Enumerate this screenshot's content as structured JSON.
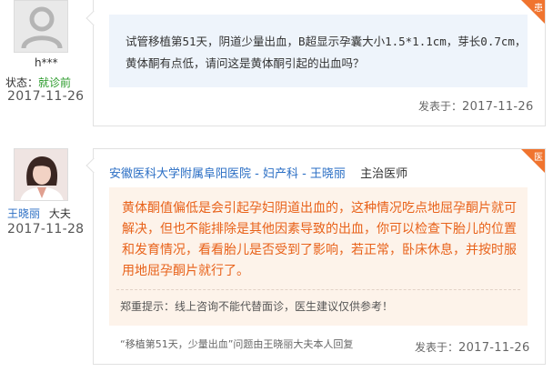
{
  "patient": {
    "name": "h***",
    "status_label": "状态：",
    "status_value": "就诊前",
    "date": "2017-11-26"
  },
  "question": {
    "badge": "患",
    "text": "试管移植第51天，阴道少量出血，B超显示孕囊大小1.5*1.1cm，芽长0.7cm，黄体酮有点低，请问这是黄体酮引起的出血吗？",
    "sent_label": "发表于：",
    "sent_date": "2017-11-26"
  },
  "doctor": {
    "name": "王晓丽",
    "role": "大夫",
    "date": "2017-11-28",
    "hospital_link": "安徽医科大学附属阜阳医院 - 妇产科 - 王晓丽",
    "title": "主治医师"
  },
  "answer": {
    "badge": "医",
    "text": "黄体酮值偏低是会引起孕妇阴道出血的，这种情况吃点地屈孕酮片就可解决，但也不能排除是其他因素导致的出血，你可以检查下胎儿的位置和发育情况，看看胎儿是否受到了影响，若正常，卧床休息，并按时服用地屈孕酮片就行了。",
    "notice": "郑重提示：线上咨询不能代替面诊，医生建议仅供参考！",
    "reply_info": "“移植第51天，少量出血”问题由王晓丽大夫本人回复",
    "sent_label": "发表于：",
    "sent_date": "2017-11-26"
  },
  "colors": {
    "badge": "#f0742f",
    "question_bg": "#eef4fb",
    "answer_bg": "#fdf3ea",
    "answer_text": "#e8621a",
    "link": "#2a6ec4",
    "status_ok": "#2a9a2a"
  }
}
